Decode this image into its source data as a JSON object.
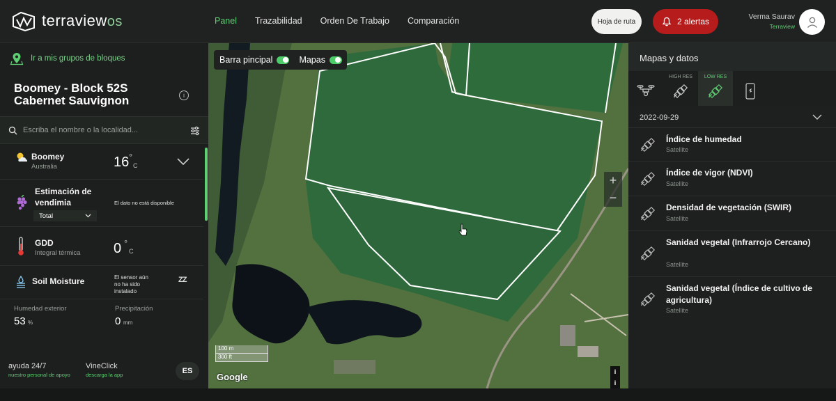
{
  "header": {
    "logo_text": "terraview",
    "logo_suffix": "os",
    "nav": [
      {
        "label": "Panel",
        "active": true
      },
      {
        "label": "Trazabilidad",
        "active": false
      },
      {
        "label": "Orden De Trabajo",
        "active": false
      },
      {
        "label": "Comparación",
        "active": false
      }
    ],
    "route_button": "Hoja de ruta",
    "alerts_button": "2 alertas",
    "user_name": "Verma Saurav",
    "user_org": "Terraview"
  },
  "left": {
    "group_link": "Ir a mis grupos de bloques",
    "block_title_line1": "Boomey - Block 52S",
    "block_title_line2": "Cabernet Sauvignon",
    "search_placeholder": "Escriba el nombre o la localidad...",
    "weather": {
      "location": "Boomey",
      "country": "Australia",
      "temp": "16",
      "unit": "°",
      "unit_letter": "C"
    },
    "harvest": {
      "label_line1": "Estimación de",
      "label_line2": "vendimia",
      "status": "El dato no está disponible",
      "select_value": "Total"
    },
    "gdd": {
      "label": "GDD",
      "sub": "Integral térmica",
      "value": "0",
      "unit": "°",
      "unit_letter": "C"
    },
    "soil": {
      "label": "Soil Moisture",
      "status_line1": "El sensor aún",
      "status_line2": "no ha sido",
      "status_line3": "instalado",
      "sleep_glyph": "ZZ"
    },
    "humidity": {
      "label": "Humedad exterior",
      "value": "53",
      "unit": "%"
    },
    "precip": {
      "label": "Precipitación",
      "value": "0",
      "unit": "mm"
    },
    "footer": {
      "help_title": "ayuda 24/7",
      "help_sub": "nuestro personal de apoyo",
      "vine_title": "VineClick",
      "vine_sub": "descarga la app",
      "lang": "ES"
    }
  },
  "map": {
    "toggle_main": "Barra pincipal",
    "toggle_maps": "Mapas",
    "zoom_in": "+",
    "zoom_out": "−",
    "scale_m": "100 m",
    "scale_ft": "300 ft",
    "attribution": "Google",
    "info": "i"
  },
  "right": {
    "title": "Mapas y datos",
    "tabs": [
      {
        "label": "",
        "icon": "drone-icon"
      },
      {
        "label": "HIGH RES",
        "icon": "satellite-icon"
      },
      {
        "label": "LOW RES",
        "icon": "satellite-icon",
        "active": true
      },
      {
        "label": "",
        "icon": "phone-icon"
      }
    ],
    "date": "2022-09-29",
    "layers": [
      {
        "name": "Índice de humedad",
        "source": "Satellite"
      },
      {
        "name": "Índice de vigor (NDVI)",
        "source": "Satellite"
      },
      {
        "name": "Densidad de vegetación (SWIR)",
        "source": "Satellite"
      },
      {
        "name": "Sanidad vegetal (Infrarrojo Cercano)",
        "source": "Satellite"
      },
      {
        "name": "Sanidad vegetal (Índice de cultivo de agricultura)",
        "source": "Satellite"
      }
    ]
  },
  "colors": {
    "accent": "#5fcf74",
    "alert": "#b71c1c",
    "panel": "#1c1f1d"
  }
}
